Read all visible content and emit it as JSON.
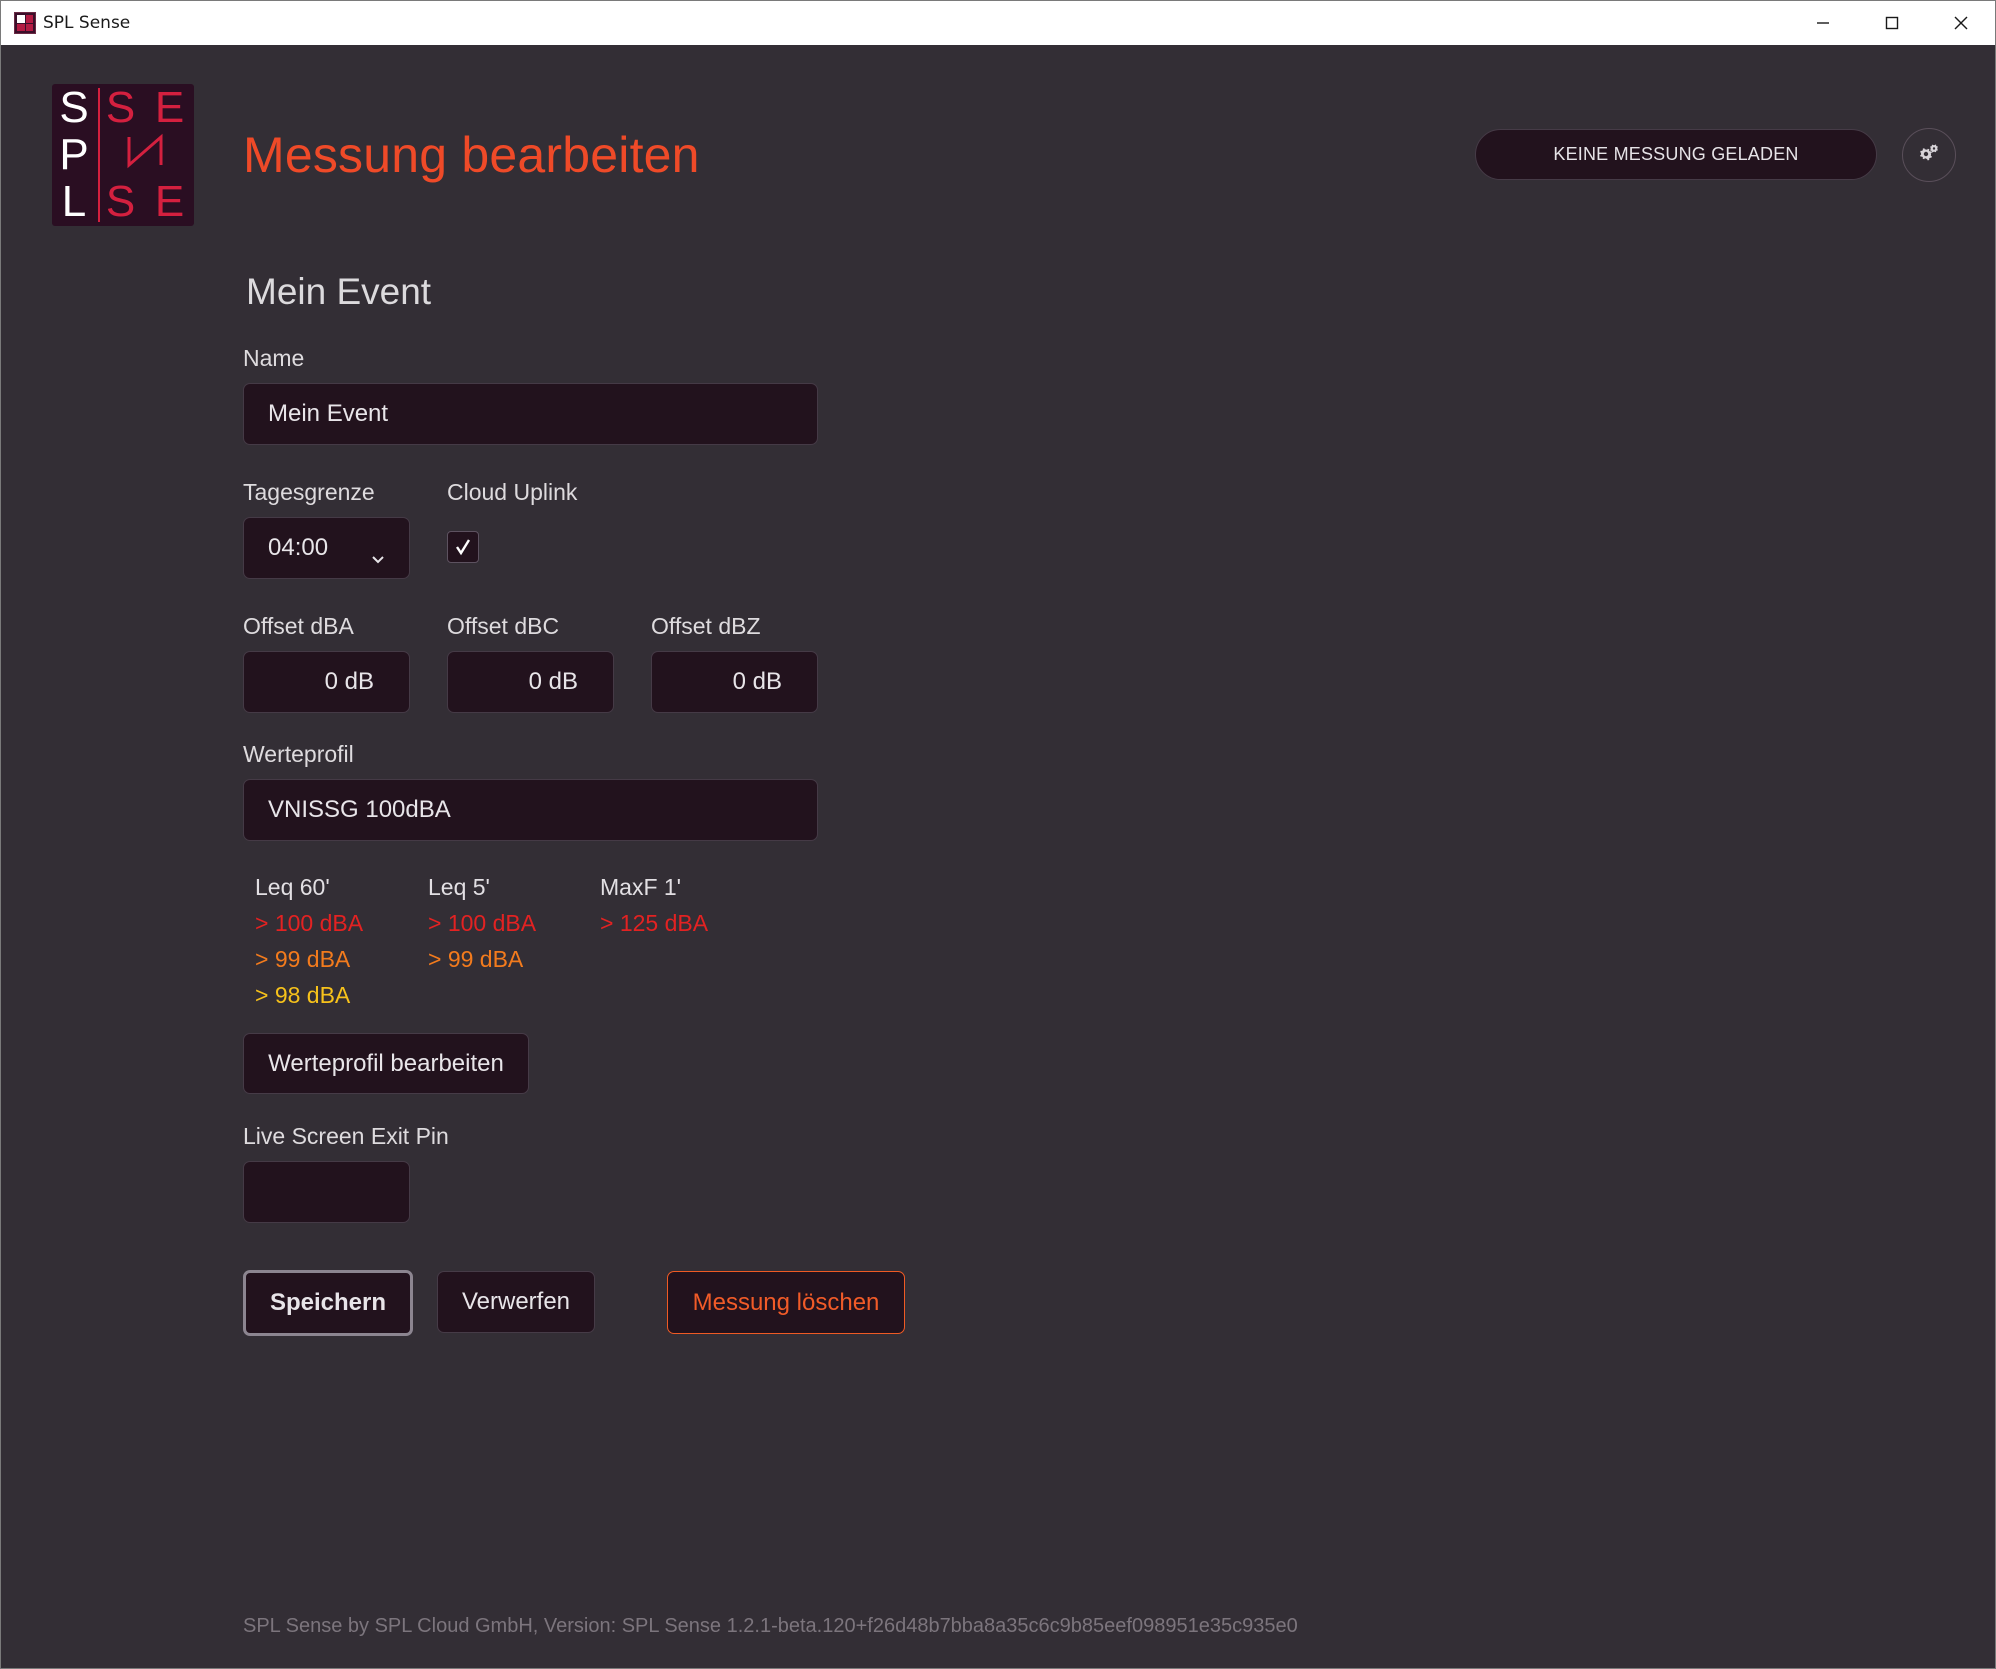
{
  "window": {
    "title": "SPL Sense"
  },
  "logo": {
    "letters": [
      "S",
      "S",
      "E",
      "P",
      "L",
      "S",
      "E"
    ]
  },
  "header": {
    "title": "Messung bearbeiten",
    "status_pill": "KEINE MESSUNG GELADEN"
  },
  "form": {
    "section_title": "Mein Event",
    "name_label": "Name",
    "name_value": "Mein Event",
    "tagesgrenze_label": "Tagesgrenze",
    "tagesgrenze_value": "04:00",
    "cloud_uplink_label": "Cloud Uplink",
    "cloud_uplink_checked": true,
    "offset_dba_label": "Offset dBA",
    "offset_dba_value": "0 dB",
    "offset_dbc_label": "Offset dBC",
    "offset_dbc_value": "0 dB",
    "offset_dbz_label": "Offset dBZ",
    "offset_dbz_value": "0 dB",
    "werteprofil_label": "Werteprofil",
    "werteprofil_value": "VNISSG 100dBA",
    "thresholds": [
      {
        "header": "Leq 60'",
        "values": [
          "> 100 dBA",
          "> 99 dBA",
          "> 98 dBA"
        ]
      },
      {
        "header": "Leq 5'",
        "values": [
          "> 100 dBA",
          "> 99 dBA"
        ]
      },
      {
        "header": "MaxF 1'",
        "values": [
          "> 125 dBA"
        ]
      }
    ],
    "threshold_colors": {
      "level1": "#e32222",
      "level2": "#f37b1d",
      "level3": "#f7c21b"
    },
    "edit_profile_button": "Werteprofil bearbeiten",
    "exit_pin_label": "Live Screen Exit Pin",
    "exit_pin_value": ""
  },
  "actions": {
    "save": "Speichern",
    "discard": "Verwerfen",
    "delete": "Messung löschen"
  },
  "footer": {
    "text": "SPL Sense by SPL Cloud GmbH, Version: SPL Sense 1.2.1-beta.120+f26d48b7bba8a35c6c9b85eef098951e35c935e0"
  },
  "colors": {
    "accent": "#ef4a28",
    "background": "#332e35",
    "field": "#22121d"
  }
}
